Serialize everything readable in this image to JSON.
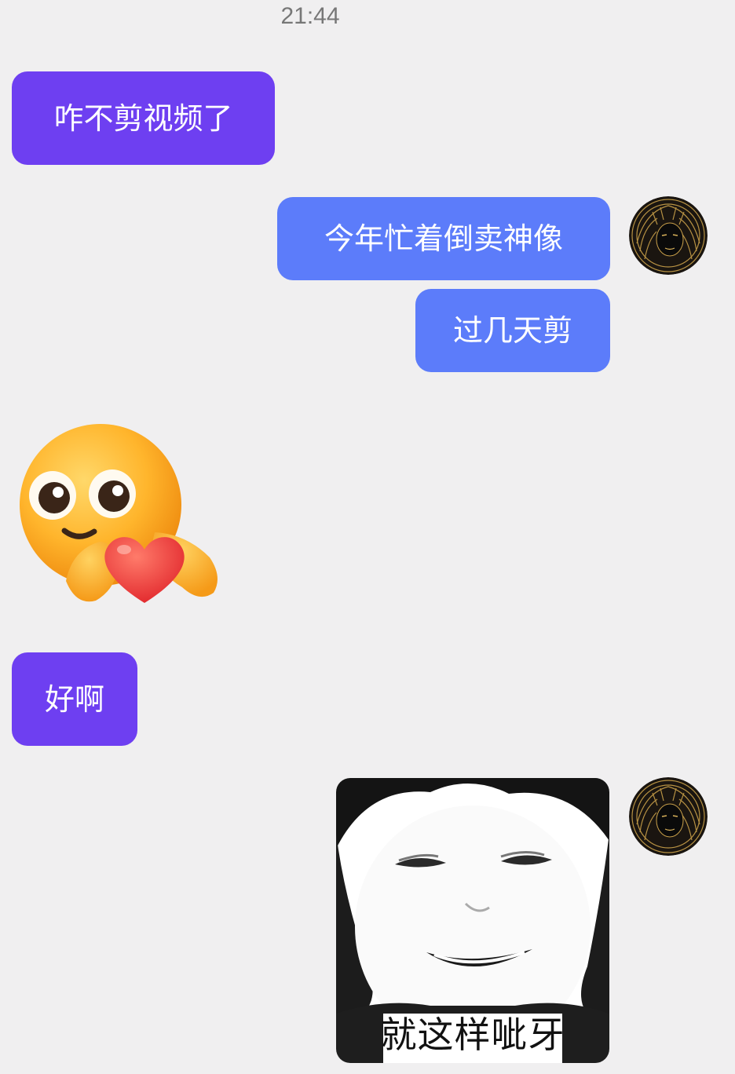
{
  "chat": {
    "timestamp": "21:44",
    "messages": [
      {
        "side": "left",
        "type": "text",
        "text": "咋不剪视频了"
      },
      {
        "side": "right",
        "type": "text",
        "text": "今年忙着倒卖神像"
      },
      {
        "side": "right",
        "type": "text",
        "text": "过几天剪"
      },
      {
        "side": "left",
        "type": "sticker",
        "icon": "smiley-holding-heart-icon"
      },
      {
        "side": "left",
        "type": "text",
        "text": "好啊"
      },
      {
        "side": "right",
        "type": "sticker",
        "icon": "meme-face-icon",
        "caption": "就这样呲牙"
      }
    ]
  },
  "colors": {
    "background": "#f0eff0",
    "left_bubble": "#6e3ff1",
    "right_bubble": "#5c7cfa",
    "timestamp": "#777777"
  }
}
